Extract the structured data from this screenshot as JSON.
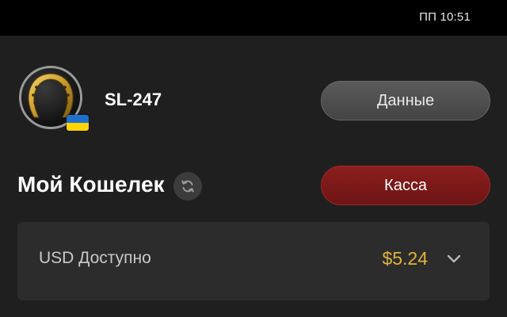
{
  "status_bar": {
    "time": "ПП 10:51"
  },
  "profile": {
    "username": "SL-247",
    "avatar_icon": "horseshoe-icon",
    "flag": "ukraine-flag",
    "data_button_label": "Данные"
  },
  "wallet": {
    "title": "Мой Кошелек",
    "refresh_icon": "refresh-icon",
    "cashier_button_label": "Касса",
    "balance": {
      "label": "USD Доступно",
      "amount": "$5.24",
      "expand_icon": "chevron-down-icon"
    }
  },
  "colors": {
    "background": "#1f1f1f",
    "status_bar": "#000000",
    "card": "#2c2c2c",
    "amount": "#e0b43a",
    "cashier_button": "#8c1e1e",
    "data_button": "#4e4e4e"
  }
}
